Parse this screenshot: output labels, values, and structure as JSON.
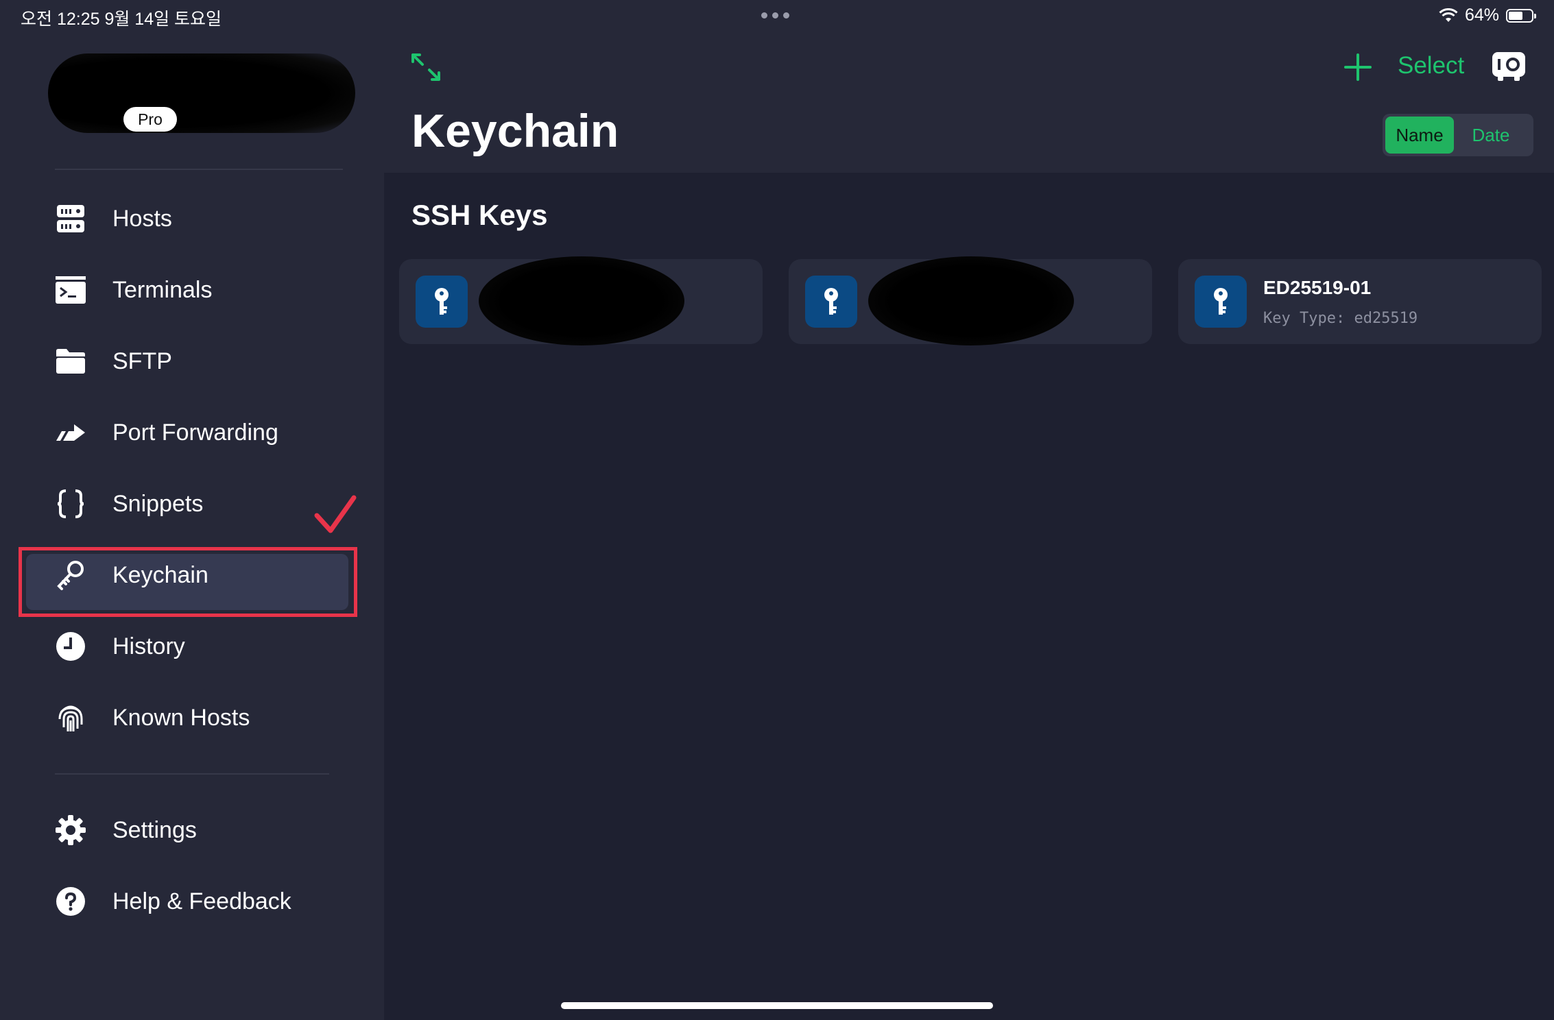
{
  "status_bar": {
    "time": "오전 12:25   9월 14일 토요일",
    "battery": "64%",
    "battery_level": 0.64
  },
  "sidebar": {
    "badge": "Pro",
    "items": [
      {
        "label": "Hosts",
        "icon": "hosts-icon"
      },
      {
        "label": "Terminals",
        "icon": "terminal-icon"
      },
      {
        "label": "SFTP",
        "icon": "folder-icon"
      },
      {
        "label": "Port Forwarding",
        "icon": "port-forward-icon"
      },
      {
        "label": "Snippets",
        "icon": "braces-icon"
      },
      {
        "label": "Keychain",
        "icon": "key-icon",
        "active": true
      },
      {
        "label": "History",
        "icon": "clock-icon"
      },
      {
        "label": "Known Hosts",
        "icon": "fingerprint-icon"
      }
    ],
    "footer": [
      {
        "label": "Settings",
        "icon": "gear-icon"
      },
      {
        "label": "Help & Feedback",
        "icon": "help-icon"
      }
    ]
  },
  "header": {
    "title": "Keychain",
    "select_label": "Select",
    "sort": {
      "options": [
        "Name",
        "Date"
      ],
      "selected": "Name"
    }
  },
  "section": {
    "title": "SSH Keys"
  },
  "keys": [
    {
      "name": "",
      "sub": ""
    },
    {
      "name": "",
      "sub": ""
    },
    {
      "name": "ED25519-01",
      "sub": "Key Type: ed25519"
    }
  ],
  "colors": {
    "accent": "#1ec46e",
    "key_tile": "#0b4a84",
    "highlight": "#e8344a"
  }
}
